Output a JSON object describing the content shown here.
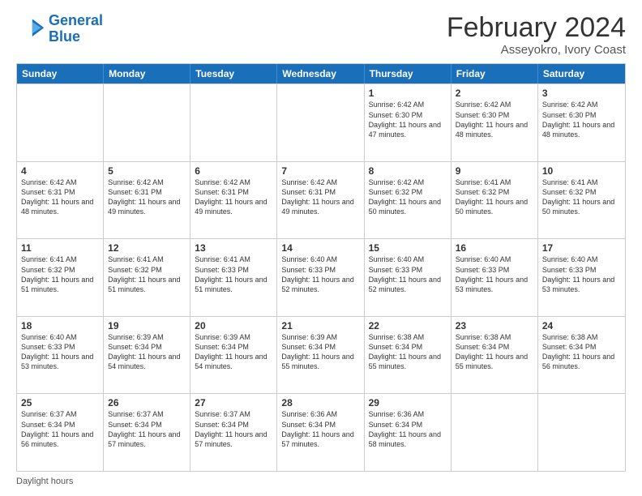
{
  "logo": {
    "text_general": "General",
    "text_blue": "Blue"
  },
  "header": {
    "title": "February 2024",
    "subtitle": "Asseyokro, Ivory Coast"
  },
  "days": [
    "Sunday",
    "Monday",
    "Tuesday",
    "Wednesday",
    "Thursday",
    "Friday",
    "Saturday"
  ],
  "weeks": [
    [
      {
        "day": "",
        "info": ""
      },
      {
        "day": "",
        "info": ""
      },
      {
        "day": "",
        "info": ""
      },
      {
        "day": "",
        "info": ""
      },
      {
        "day": "1",
        "info": "Sunrise: 6:42 AM\nSunset: 6:30 PM\nDaylight: 11 hours and 47 minutes."
      },
      {
        "day": "2",
        "info": "Sunrise: 6:42 AM\nSunset: 6:30 PM\nDaylight: 11 hours and 48 minutes."
      },
      {
        "day": "3",
        "info": "Sunrise: 6:42 AM\nSunset: 6:30 PM\nDaylight: 11 hours and 48 minutes."
      }
    ],
    [
      {
        "day": "4",
        "info": "Sunrise: 6:42 AM\nSunset: 6:31 PM\nDaylight: 11 hours and 48 minutes."
      },
      {
        "day": "5",
        "info": "Sunrise: 6:42 AM\nSunset: 6:31 PM\nDaylight: 11 hours and 49 minutes."
      },
      {
        "day": "6",
        "info": "Sunrise: 6:42 AM\nSunset: 6:31 PM\nDaylight: 11 hours and 49 minutes."
      },
      {
        "day": "7",
        "info": "Sunrise: 6:42 AM\nSunset: 6:31 PM\nDaylight: 11 hours and 49 minutes."
      },
      {
        "day": "8",
        "info": "Sunrise: 6:42 AM\nSunset: 6:32 PM\nDaylight: 11 hours and 50 minutes."
      },
      {
        "day": "9",
        "info": "Sunrise: 6:41 AM\nSunset: 6:32 PM\nDaylight: 11 hours and 50 minutes."
      },
      {
        "day": "10",
        "info": "Sunrise: 6:41 AM\nSunset: 6:32 PM\nDaylight: 11 hours and 50 minutes."
      }
    ],
    [
      {
        "day": "11",
        "info": "Sunrise: 6:41 AM\nSunset: 6:32 PM\nDaylight: 11 hours and 51 minutes."
      },
      {
        "day": "12",
        "info": "Sunrise: 6:41 AM\nSunset: 6:32 PM\nDaylight: 11 hours and 51 minutes."
      },
      {
        "day": "13",
        "info": "Sunrise: 6:41 AM\nSunset: 6:33 PM\nDaylight: 11 hours and 51 minutes."
      },
      {
        "day": "14",
        "info": "Sunrise: 6:40 AM\nSunset: 6:33 PM\nDaylight: 11 hours and 52 minutes."
      },
      {
        "day": "15",
        "info": "Sunrise: 6:40 AM\nSunset: 6:33 PM\nDaylight: 11 hours and 52 minutes."
      },
      {
        "day": "16",
        "info": "Sunrise: 6:40 AM\nSunset: 6:33 PM\nDaylight: 11 hours and 53 minutes."
      },
      {
        "day": "17",
        "info": "Sunrise: 6:40 AM\nSunset: 6:33 PM\nDaylight: 11 hours and 53 minutes."
      }
    ],
    [
      {
        "day": "18",
        "info": "Sunrise: 6:40 AM\nSunset: 6:33 PM\nDaylight: 11 hours and 53 minutes."
      },
      {
        "day": "19",
        "info": "Sunrise: 6:39 AM\nSunset: 6:34 PM\nDaylight: 11 hours and 54 minutes."
      },
      {
        "day": "20",
        "info": "Sunrise: 6:39 AM\nSunset: 6:34 PM\nDaylight: 11 hours and 54 minutes."
      },
      {
        "day": "21",
        "info": "Sunrise: 6:39 AM\nSunset: 6:34 PM\nDaylight: 11 hours and 55 minutes."
      },
      {
        "day": "22",
        "info": "Sunrise: 6:38 AM\nSunset: 6:34 PM\nDaylight: 11 hours and 55 minutes."
      },
      {
        "day": "23",
        "info": "Sunrise: 6:38 AM\nSunset: 6:34 PM\nDaylight: 11 hours and 55 minutes."
      },
      {
        "day": "24",
        "info": "Sunrise: 6:38 AM\nSunset: 6:34 PM\nDaylight: 11 hours and 56 minutes."
      }
    ],
    [
      {
        "day": "25",
        "info": "Sunrise: 6:37 AM\nSunset: 6:34 PM\nDaylight: 11 hours and 56 minutes."
      },
      {
        "day": "26",
        "info": "Sunrise: 6:37 AM\nSunset: 6:34 PM\nDaylight: 11 hours and 57 minutes."
      },
      {
        "day": "27",
        "info": "Sunrise: 6:37 AM\nSunset: 6:34 PM\nDaylight: 11 hours and 57 minutes."
      },
      {
        "day": "28",
        "info": "Sunrise: 6:36 AM\nSunset: 6:34 PM\nDaylight: 11 hours and 57 minutes."
      },
      {
        "day": "29",
        "info": "Sunrise: 6:36 AM\nSunset: 6:34 PM\nDaylight: 11 hours and 58 minutes."
      },
      {
        "day": "",
        "info": ""
      },
      {
        "day": "",
        "info": ""
      }
    ]
  ],
  "footer": {
    "daylight_label": "Daylight hours"
  }
}
